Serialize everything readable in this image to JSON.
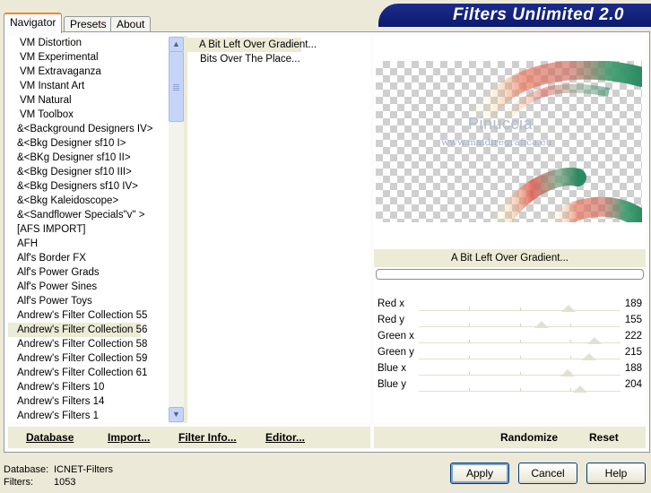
{
  "tabs": [
    {
      "label": "Navigator"
    },
    {
      "label": "Presets"
    },
    {
      "label": "About"
    }
  ],
  "app_title": "Filters Unlimited 2.0",
  "categories": [
    "VM Distortion",
    "VM Experimental",
    "VM Extravaganza",
    "VM Instant Art",
    "VM Natural",
    "VM Toolbox",
    "&<Background Designers IV>",
    "&<Bkg Designer sf10 I>",
    "&<BKg Designer sf10 II>",
    "&<Bkg Designer sf10 III>",
    "&<Bkg Designers sf10 IV>",
    "&<Bkg Kaleidoscope>",
    "&<Sandflower Specials\"v\" >",
    "[AFS IMPORT]",
    "AFH",
    "Alf's Border FX",
    "Alf's Power Grads",
    "Alf's Power Sines",
    "Alf's Power Toys",
    "Andrew's Filter Collection 55",
    "Andrew's Filter Collection 56",
    "Andrew's Filter Collection 58",
    "Andrew's Filter Collection 59",
    "Andrew's Filter Collection 61",
    "Andrew's Filters 10",
    "Andrew's Filters 14",
    "Andrew's Filters 1"
  ],
  "selected_category": "Andrew's Filter Collection 56",
  "filters": [
    "A Bit Left Over Gradient...",
    "Bits Over The Place..."
  ],
  "selected_filter": "A Bit Left Over Gradient...",
  "preview_filter_name": "A Bit Left Over Gradient...",
  "progress": 0,
  "sliders": [
    {
      "label": "Red x",
      "value": "189",
      "fraction": 0.741
    },
    {
      "label": "Red y",
      "value": "155",
      "fraction": 0.608
    },
    {
      "label": "Green x",
      "value": "222",
      "fraction": 0.871
    },
    {
      "label": "Green y",
      "value": "215",
      "fraction": 0.843
    },
    {
      "label": "Blue x",
      "value": "188",
      "fraction": 0.737
    },
    {
      "label": "Blue y",
      "value": "204",
      "fraction": 0.8
    }
  ],
  "watermark": {
    "name": "Pinuccia",
    "url": "www.maidiregrafica.eu"
  },
  "left_buttons": {
    "database": "Database",
    "import": "Import...",
    "filter_info": "Filter Info...",
    "editor": "Editor..."
  },
  "right_buttons": {
    "randomize": "Randomize",
    "reset": "Reset"
  },
  "status": {
    "database_label": "Database:",
    "database_value": "ICNET-Filters",
    "filters_label": "Filters:",
    "filters_value": "1053"
  },
  "dialog_buttons": {
    "apply": "Apply",
    "cancel": "Cancel",
    "help": "Help"
  },
  "colors": {
    "banner": "#0b1a6c",
    "selection": "#ecebd6",
    "tab_accent": "#e68b2c"
  }
}
